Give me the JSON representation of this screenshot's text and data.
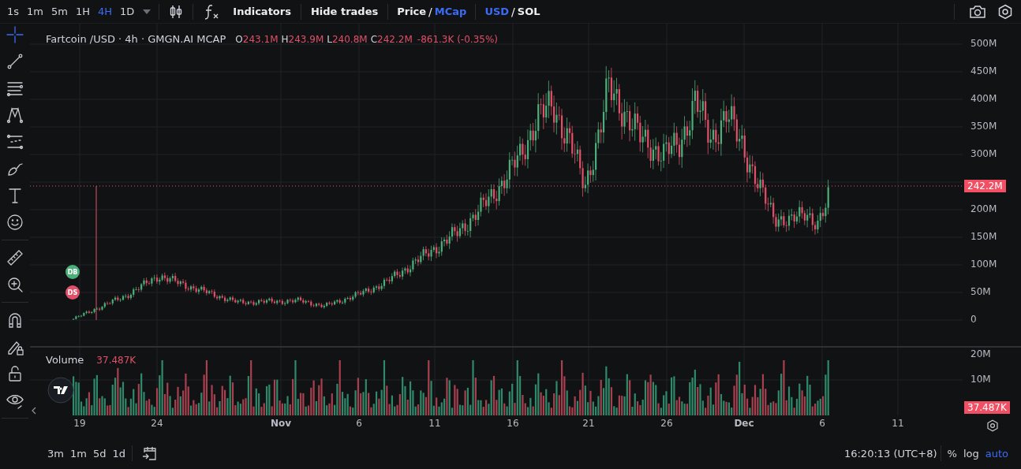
{
  "toolbar": {
    "intervals": [
      {
        "label": "1s",
        "selected": false
      },
      {
        "label": "1m",
        "selected": false
      },
      {
        "label": "5m",
        "selected": false
      },
      {
        "label": "1H",
        "selected": false
      },
      {
        "label": "4H",
        "selected": true
      },
      {
        "label": "1D",
        "selected": false
      }
    ],
    "indicators": "Indicators",
    "hide_trades": "Hide trades",
    "price_toggle": {
      "separator": "/",
      "options": [
        {
          "label": "Price",
          "selected": false
        },
        {
          "label": "MCap",
          "selected": true
        }
      ]
    },
    "currency_toggle": {
      "separator": "/",
      "options": [
        {
          "label": "USD",
          "selected": true
        },
        {
          "label": "SOL",
          "selected": false
        }
      ]
    }
  },
  "tools": [
    {
      "kind": "crosshair",
      "selected": true
    },
    {
      "kind": "trend-line",
      "selected": false
    },
    {
      "kind": "lines",
      "selected": false
    },
    {
      "kind": "pattern",
      "selected": false
    },
    {
      "kind": "projection",
      "selected": false
    },
    {
      "kind": "brush",
      "selected": false
    },
    {
      "kind": "text",
      "selected": false
    },
    {
      "kind": "emoji",
      "selected": false
    },
    {
      "kind": "ruler",
      "selected": false
    },
    {
      "kind": "zoom",
      "selected": false
    },
    {
      "kind": "magnet",
      "selected": false
    },
    {
      "kind": "lock-draw",
      "selected": false
    },
    {
      "kind": "lock",
      "selected": false
    },
    {
      "kind": "eye",
      "selected": false
    }
  ],
  "legend": {
    "symbol": "Fartcoin /USD · 4h · GMGN.AI MCAP",
    "values": [
      {
        "key": "O",
        "value": "243.1M"
      },
      {
        "key": "H",
        "value": "243.9M"
      },
      {
        "key": "L",
        "value": "240.8M"
      },
      {
        "key": "C",
        "value": "242.2M"
      }
    ],
    "change": "-861.3K (-0.35%)"
  },
  "markers": [
    {
      "label": "DB",
      "kind": "buy"
    },
    {
      "label": "DS",
      "kind": "sell"
    }
  ],
  "price_axis": [
    "500M",
    "450M",
    "400M",
    "350M",
    "300M",
    "200M",
    "150M",
    "100M",
    "50M",
    "0"
  ],
  "price_badge": "242.2M",
  "volume": {
    "label": "Volume",
    "value": "37.487K",
    "axis": [
      "20M",
      "10M"
    ],
    "badge": "37.487K"
  },
  "time_axis": [
    {
      "label": "19",
      "kind": "day"
    },
    {
      "label": "24",
      "kind": "day"
    },
    {
      "label": "Nov",
      "kind": "month"
    },
    {
      "label": "6",
      "kind": "day"
    },
    {
      "label": "11",
      "kind": "day"
    },
    {
      "label": "16",
      "kind": "day"
    },
    {
      "label": "21",
      "kind": "day"
    },
    {
      "label": "26",
      "kind": "day"
    },
    {
      "label": "Dec",
      "kind": "month"
    },
    {
      "label": "6",
      "kind": "day"
    },
    {
      "label": "11",
      "kind": "day"
    }
  ],
  "ranges": [
    "3m",
    "1m",
    "5d",
    "1d"
  ],
  "clock": "16:20:13 (UTC+8)",
  "scale_options": [
    {
      "label": "%",
      "selected": false
    },
    {
      "label": "log",
      "selected": false
    },
    {
      "label": "auto",
      "selected": true
    }
  ]
}
